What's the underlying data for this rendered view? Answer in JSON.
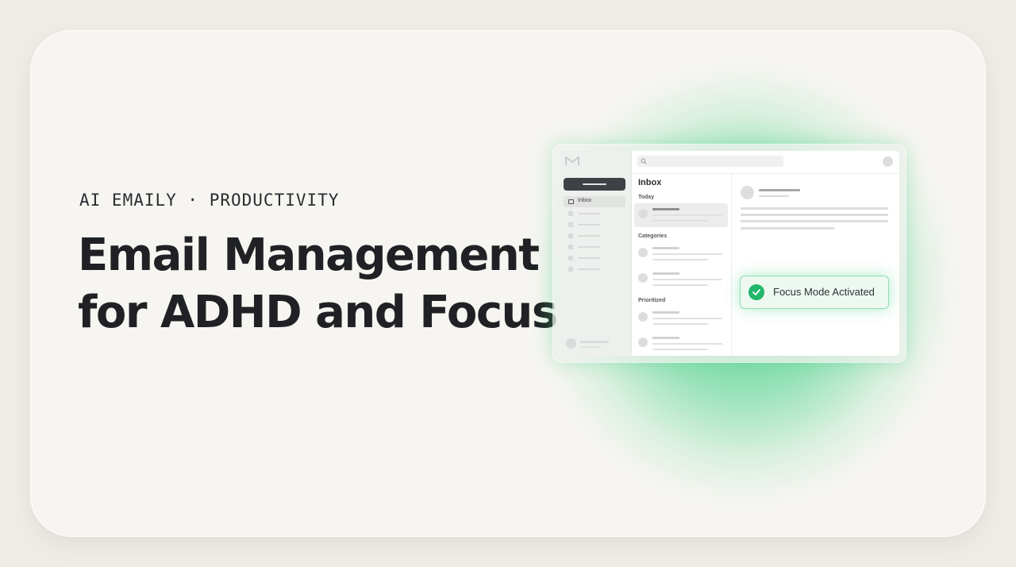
{
  "hero": {
    "eyebrow": "AI EMAILY · PRODUCTIVITY",
    "headline_line1": "Email Management",
    "headline_line2": "for ADHD and Focus"
  },
  "app_mockup": {
    "sidebar": {
      "logo_icon": "mail-logo-icon",
      "inbox_label": "Inbox"
    },
    "list": {
      "title": "Inbox",
      "sections": [
        "Today",
        "Categories",
        "Prioritized"
      ]
    },
    "toast": {
      "message": "Focus Mode Activated",
      "icon": "check-circle-icon"
    }
  },
  "colors": {
    "background": "#efece6",
    "card": "#f6f5f1",
    "accent_green": "#22b76a",
    "glow_green": "#34c878",
    "headline_text": "#1f2124"
  }
}
